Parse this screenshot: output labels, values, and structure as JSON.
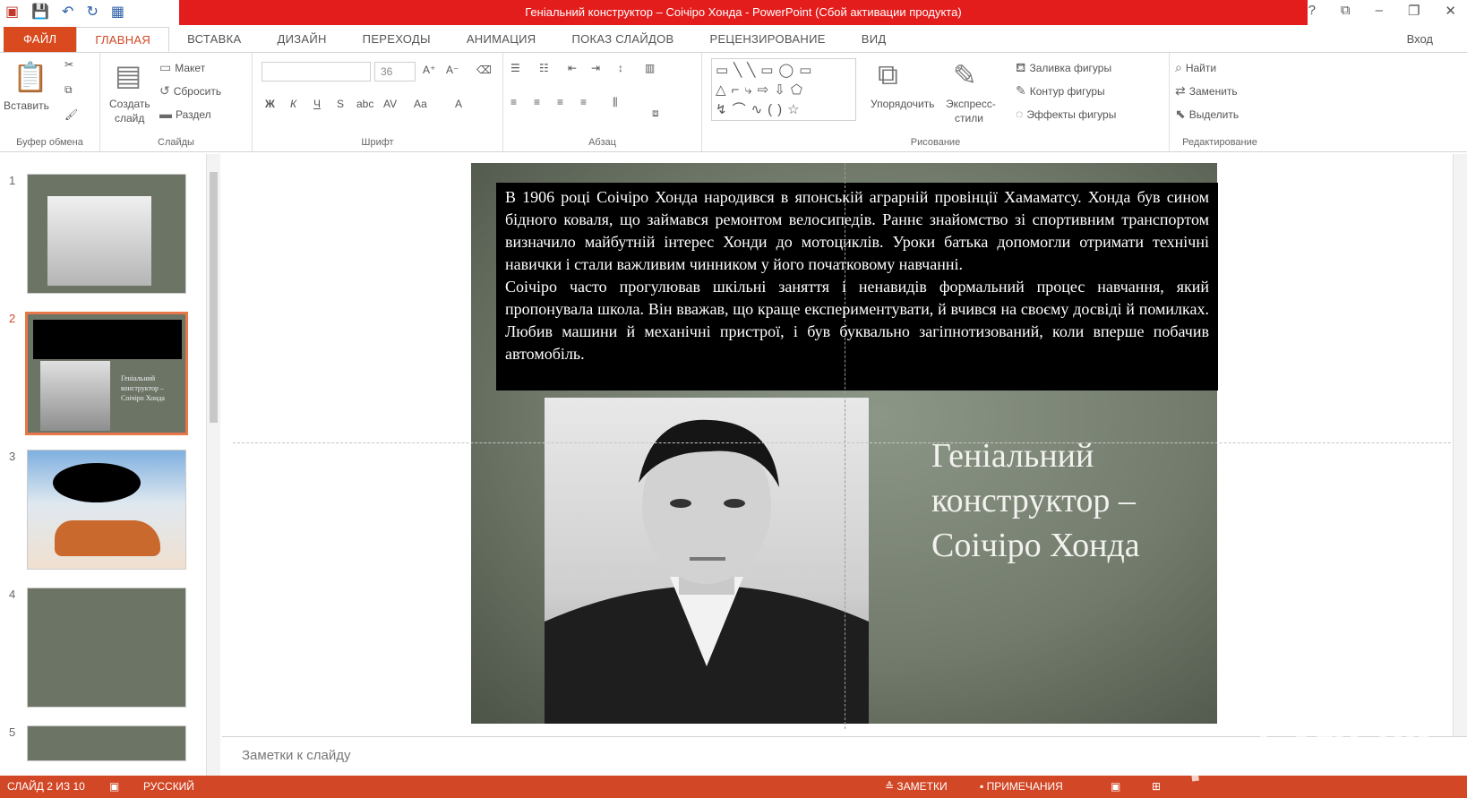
{
  "title": "Геніальний конструктор – Соічіро Хонда - PowerPoint (Сбой активации продукта)",
  "window_buttons": [
    "?",
    "⧉",
    "–",
    "❐",
    "✕"
  ],
  "tabs": [
    "ФАЙЛ",
    "ГЛАВНАЯ",
    "ВСТАВКА",
    "ДИЗАЙН",
    "ПЕРЕХОДЫ",
    "АНИМАЦИЯ",
    "ПОКАЗ СЛАЙДОВ",
    "РЕЦЕНЗИРОВАНИЕ",
    "ВИД"
  ],
  "signin": "Вход",
  "ribbon": {
    "clipboard": {
      "paste": "Вставить",
      "label": "Буфер обмена"
    },
    "slides": {
      "new_slide_line1": "Создать",
      "new_slide_line2": "слайд",
      "layout": "Макет",
      "reset": "Сбросить",
      "section": "Раздел",
      "label": "Слайды"
    },
    "font": {
      "size": "36",
      "bold": "Ж",
      "italic": "К",
      "underline": "Ч",
      "strike": "S",
      "case": "Аа",
      "label": "Шрифт"
    },
    "paragraph": {
      "label": "Абзац"
    },
    "drawing": {
      "arrange": "Упорядочить",
      "quick_styles_line1": "Экспресс-",
      "quick_styles_line2": "стили",
      "fill": "Заливка фигуры",
      "outline": "Контур фигуры",
      "effects": "Эффекты фигуры",
      "label": "Рисование"
    },
    "editing": {
      "find": "Найти",
      "replace": "Заменить",
      "select": "Выделить",
      "label": "Редактирование"
    }
  },
  "thumbnails": [
    {
      "num": "1"
    },
    {
      "num": "2",
      "caption_line1": "Геніальний",
      "caption_line2": "конструктор –",
      "caption_line3": "Соічіро Хонда"
    },
    {
      "num": "3"
    },
    {
      "num": "4"
    },
    {
      "num": "5"
    }
  ],
  "slide": {
    "paragraph1": "В 1906 році Соічіро Хонда народився в японській аграрній провінції Хамаматсу. Хонда був сином бідного коваля, що займався ремонтом велосипедів. Раннє знайомство зі спортивним транспортом визначило майбутній інтерес Хонди до мотоциклів. Уроки батька допомогли отримати технічні навички і стали важливим чинником у його початковому навчанні.",
    "paragraph2": "Соічіро часто прогулював шкільні заняття і ненавидів формальний процес навчання, який пропонувала школа. Він вважав, що краще експериментувати, й вчився на своєму досвіді й помилках. Любив машини й механічні пристрої, і був буквально загіпнотизований, коли вперше побачив автомобіль.",
    "title_line1": "Геніальний",
    "title_line2": "конструктор –",
    "title_line3": "Соічіро Хонда"
  },
  "notes_placeholder": "Заметки к слайду",
  "status": {
    "slide": "СЛАЙД 2 ИЗ 10",
    "language": "РУССКИЙ",
    "notes": "ЗАМЕТКИ",
    "comments": "ПРИМЕЧАНИЯ"
  },
  "watermark": "ipati.org.ua",
  "colors": {
    "accent": "#d24726",
    "title_bar": "#e31c1c",
    "slide_bg": "#727b6c"
  }
}
